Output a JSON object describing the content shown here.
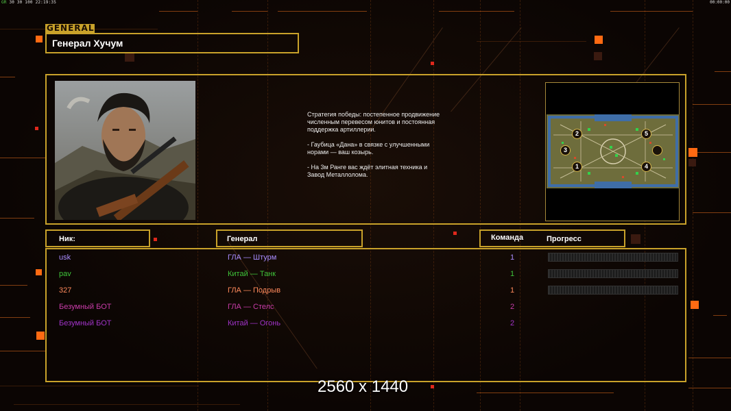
{
  "status_bar": {
    "left_fps": "GR",
    "left_values": "30 30 100",
    "left_time": "22:19:35",
    "right_time": "00:00:00"
  },
  "general_tag": "GENERAL",
  "general_name": "Генерал Хучум",
  "description": [
    "Стратегия победы: постепенное продвижение численным перевесом юнитов и постоянная поддержка артиллерии.",
    "- Гаубица «Дана» в связке с улучшенными норами — ваш козырь.",
    "- На 3м Ранге вас ждёт элитная техника и Завод Металлолома."
  ],
  "map": {
    "start_positions": [
      "1",
      "2",
      "3",
      "4",
      "5",
      ""
    ]
  },
  "headers": {
    "nick": "Ник:",
    "general": "Генерал",
    "team": "Команда",
    "progress": "Прогресс"
  },
  "players": [
    {
      "nick": "usk",
      "general": "ГЛА — Штурм",
      "team": "1",
      "color": "#a98cff",
      "progress": true
    },
    {
      "nick": "pav",
      "general": "Китай — Танк",
      "team": "1",
      "color": "#3fc43a",
      "progress": true
    },
    {
      "nick": "327",
      "general": "ГЛА — Подрыв",
      "team": "1",
      "color": "#ff8a5c",
      "progress": true
    },
    {
      "nick": "Безумный БОТ",
      "general": "ГЛА — Стелс",
      "team": "2",
      "color": "#c83ca8",
      "progress": false
    },
    {
      "nick": "Безумный БОТ",
      "general": "Китай — Огонь",
      "team": "2",
      "color": "#a033c8",
      "progress": false
    }
  ],
  "resolution_label": "2560 x 1440",
  "colors": {
    "panel_border": "#c9a22a",
    "accent_orange": "#ff6a12",
    "accent_red": "#e0281c"
  }
}
